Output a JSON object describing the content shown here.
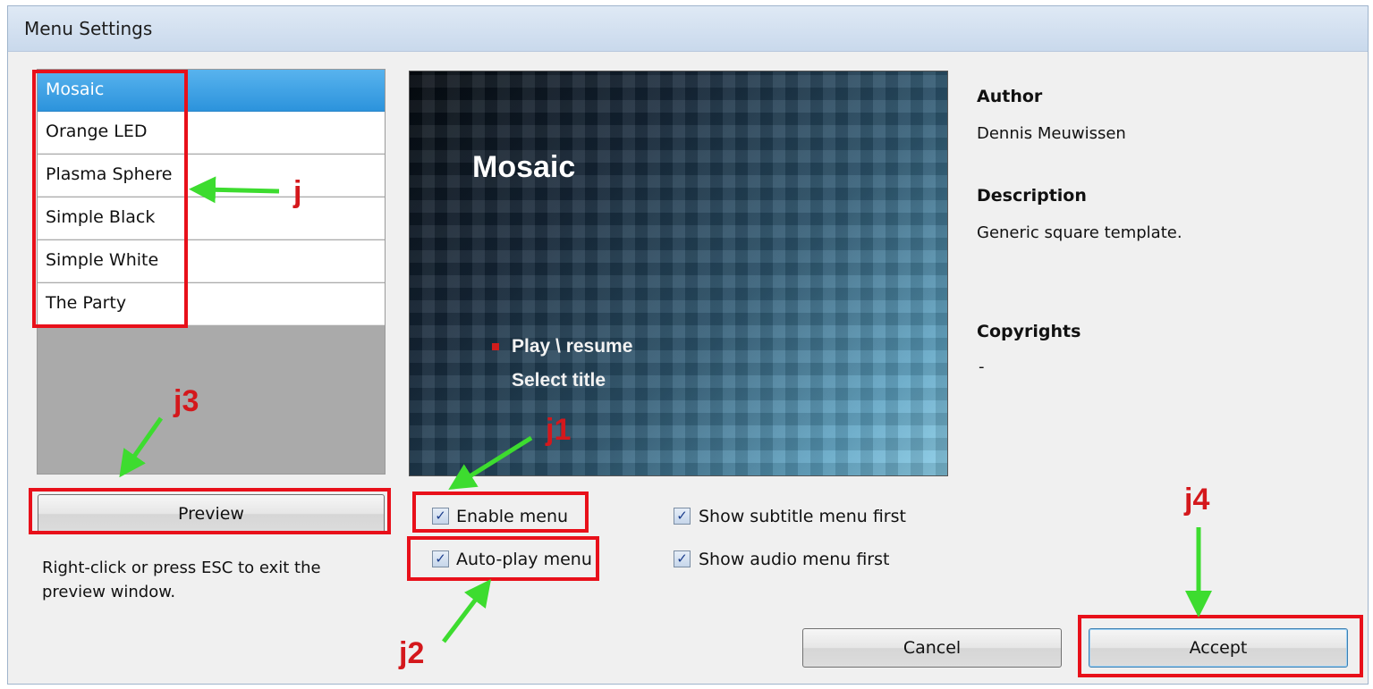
{
  "window": {
    "title": "Menu Settings"
  },
  "templates": {
    "items": [
      {
        "label": "Mosaic",
        "selected": true
      },
      {
        "label": "Orange LED",
        "selected": false
      },
      {
        "label": "Plasma Sphere",
        "selected": false
      },
      {
        "label": "Simple Black",
        "selected": false
      },
      {
        "label": "Simple White",
        "selected": false
      },
      {
        "label": "The Party",
        "selected": false
      }
    ]
  },
  "preview_area": {
    "title": "Mosaic",
    "menu_items": [
      "Play \\ resume",
      "Select title"
    ]
  },
  "preview_button": {
    "label": "Preview"
  },
  "hint": {
    "line1": "Right-click or press ESC to exit the",
    "line2": "preview window."
  },
  "options": {
    "enable_menu": {
      "label": "Enable menu",
      "checked": true
    },
    "auto_play_menu": {
      "label": "Auto-play menu",
      "checked": true
    },
    "show_subtitle_first": {
      "label": "Show subtitle menu first",
      "checked": true
    },
    "show_audio_first": {
      "label": "Show audio menu first",
      "checked": true
    }
  },
  "info": {
    "author_heading": "Author",
    "author": "Dennis Meuwissen",
    "description_heading": "Description",
    "description": "Generic square template.",
    "copyrights_heading": "Copyrights",
    "copyrights": "-"
  },
  "buttons": {
    "cancel": "Cancel",
    "accept": "Accept"
  },
  "annotations": {
    "j": "j",
    "j1": "j1",
    "j2": "j2",
    "j3": "j3",
    "j4": "j4"
  },
  "colors": {
    "annotation_red": "#e8101a",
    "arrow_green": "#3ddc2f",
    "selection_blue": "#3399e0"
  }
}
